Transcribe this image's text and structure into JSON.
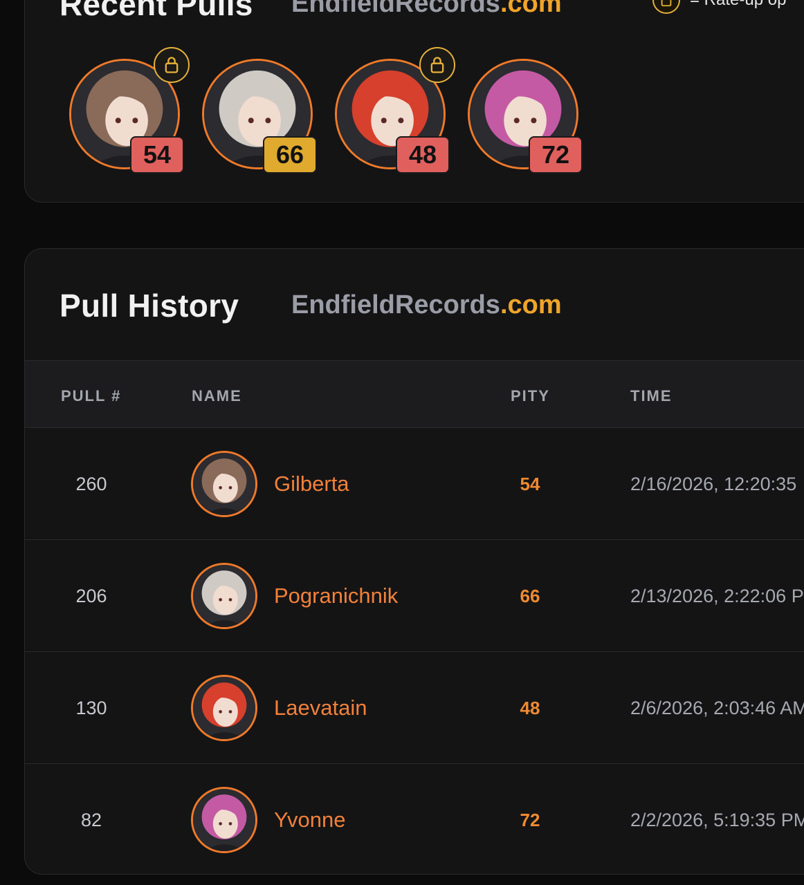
{
  "recent": {
    "title": "Recent Pulls",
    "brand_main": "EndfieldRecords",
    "brand_tld": ".com",
    "legend_text": "= Rate-up op",
    "pulls": [
      {
        "name": "Gilberta",
        "pity": "54",
        "rate_up": true,
        "badge_color": "#e0605e",
        "hair": "#8a6a58"
      },
      {
        "name": "Pogranichnik",
        "pity": "66",
        "rate_up": false,
        "badge_color": "#dfaa2e",
        "hair": "#cfcac4"
      },
      {
        "name": "Laevatain",
        "pity": "48",
        "rate_up": true,
        "badge_color": "#e0605e",
        "hair": "#d6402c"
      },
      {
        "name": "Yvonne",
        "pity": "72",
        "rate_up": false,
        "badge_color": "#e0605e",
        "hair": "#c45aa4"
      }
    ]
  },
  "history": {
    "title": "Pull History",
    "brand_main": "EndfieldRecords",
    "brand_tld": ".com",
    "columns": {
      "pull": "PULL #",
      "name": "NAME",
      "pity": "PITY",
      "time": "TIME"
    },
    "rows": [
      {
        "pull": "260",
        "name": "Gilberta",
        "pity": "54",
        "time": "2/16/2026, 12:20:35",
        "hair": "#8a6a58"
      },
      {
        "pull": "206",
        "name": "Pogranichnik",
        "pity": "66",
        "time": "2/13/2026, 2:22:06 P",
        "hair": "#cfcac4"
      },
      {
        "pull": "130",
        "name": "Laevatain",
        "pity": "48",
        "time": "2/6/2026, 2:03:46 AM",
        "hair": "#d6402c"
      },
      {
        "pull": "82",
        "name": "Yvonne",
        "pity": "72",
        "time": "2/2/2026, 5:19:35 PM",
        "hair": "#c45aa4"
      }
    ]
  },
  "colors": {
    "accent": "#ef7a2a",
    "brand_tld": "#f0a52a",
    "lock": "#e7b23a"
  }
}
